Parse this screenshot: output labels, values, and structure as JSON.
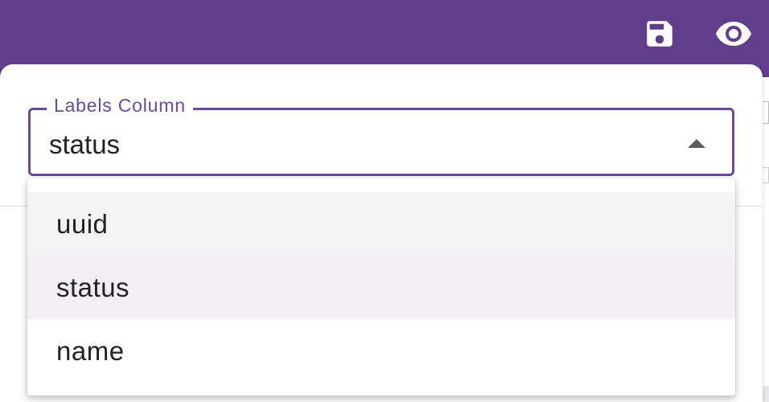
{
  "toolbar": {
    "save_icon": "save-icon",
    "preview_icon": "eye-icon",
    "background_color": "#613d8b"
  },
  "labels_select": {
    "label": "Labels Column",
    "value": "status",
    "accent_color": "#6a4a97",
    "expanded": true
  },
  "dropdown": {
    "options": [
      {
        "label": "uuid",
        "state": "hovered"
      },
      {
        "label": "status",
        "state": "selected"
      },
      {
        "label": "name",
        "state": "normal"
      }
    ]
  }
}
